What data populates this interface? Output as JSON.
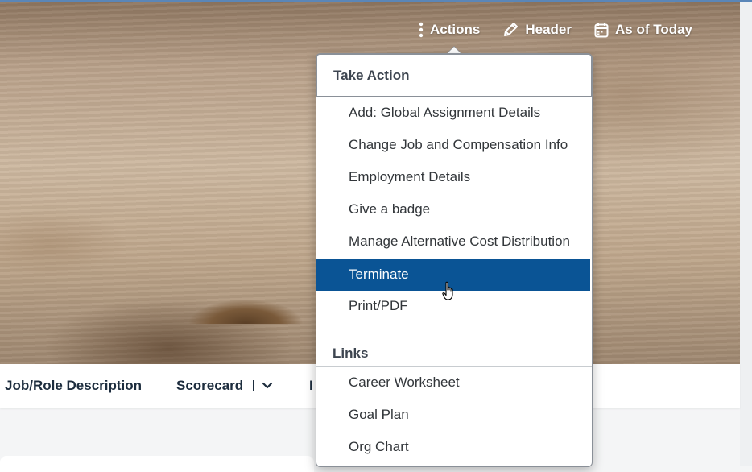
{
  "header": {
    "actions": [
      {
        "label": "Actions",
        "icon": "vertical-ellipsis-icon"
      },
      {
        "label": "Header",
        "icon": "pencil-icon"
      },
      {
        "label": "As of Today",
        "icon": "calendar-icon"
      }
    ]
  },
  "tabs": [
    {
      "label": "Job/Role Description"
    },
    {
      "label": "Scorecard",
      "icon": "chevron-down-icon"
    },
    {
      "label": "I"
    }
  ],
  "menu": {
    "groups": [
      {
        "header": "Take Action",
        "items": [
          {
            "label": "Add: Global Assignment Details"
          },
          {
            "label": "Change Job and Compensation Info"
          },
          {
            "label": "Employment Details"
          },
          {
            "label": "Give a badge"
          },
          {
            "label": "Manage Alternative Cost Distribution"
          },
          {
            "label": "Terminate",
            "selected": true
          },
          {
            "label": "Print/PDF"
          }
        ]
      },
      {
        "header": "Links",
        "items": [
          {
            "label": "Career Worksheet"
          },
          {
            "label": "Goal Plan"
          },
          {
            "label": "Org Chart"
          }
        ]
      }
    ]
  },
  "colors": {
    "selected_bg": "#0a5495",
    "text_dark": "#1d2d3e",
    "menu_text": "#32363a"
  }
}
